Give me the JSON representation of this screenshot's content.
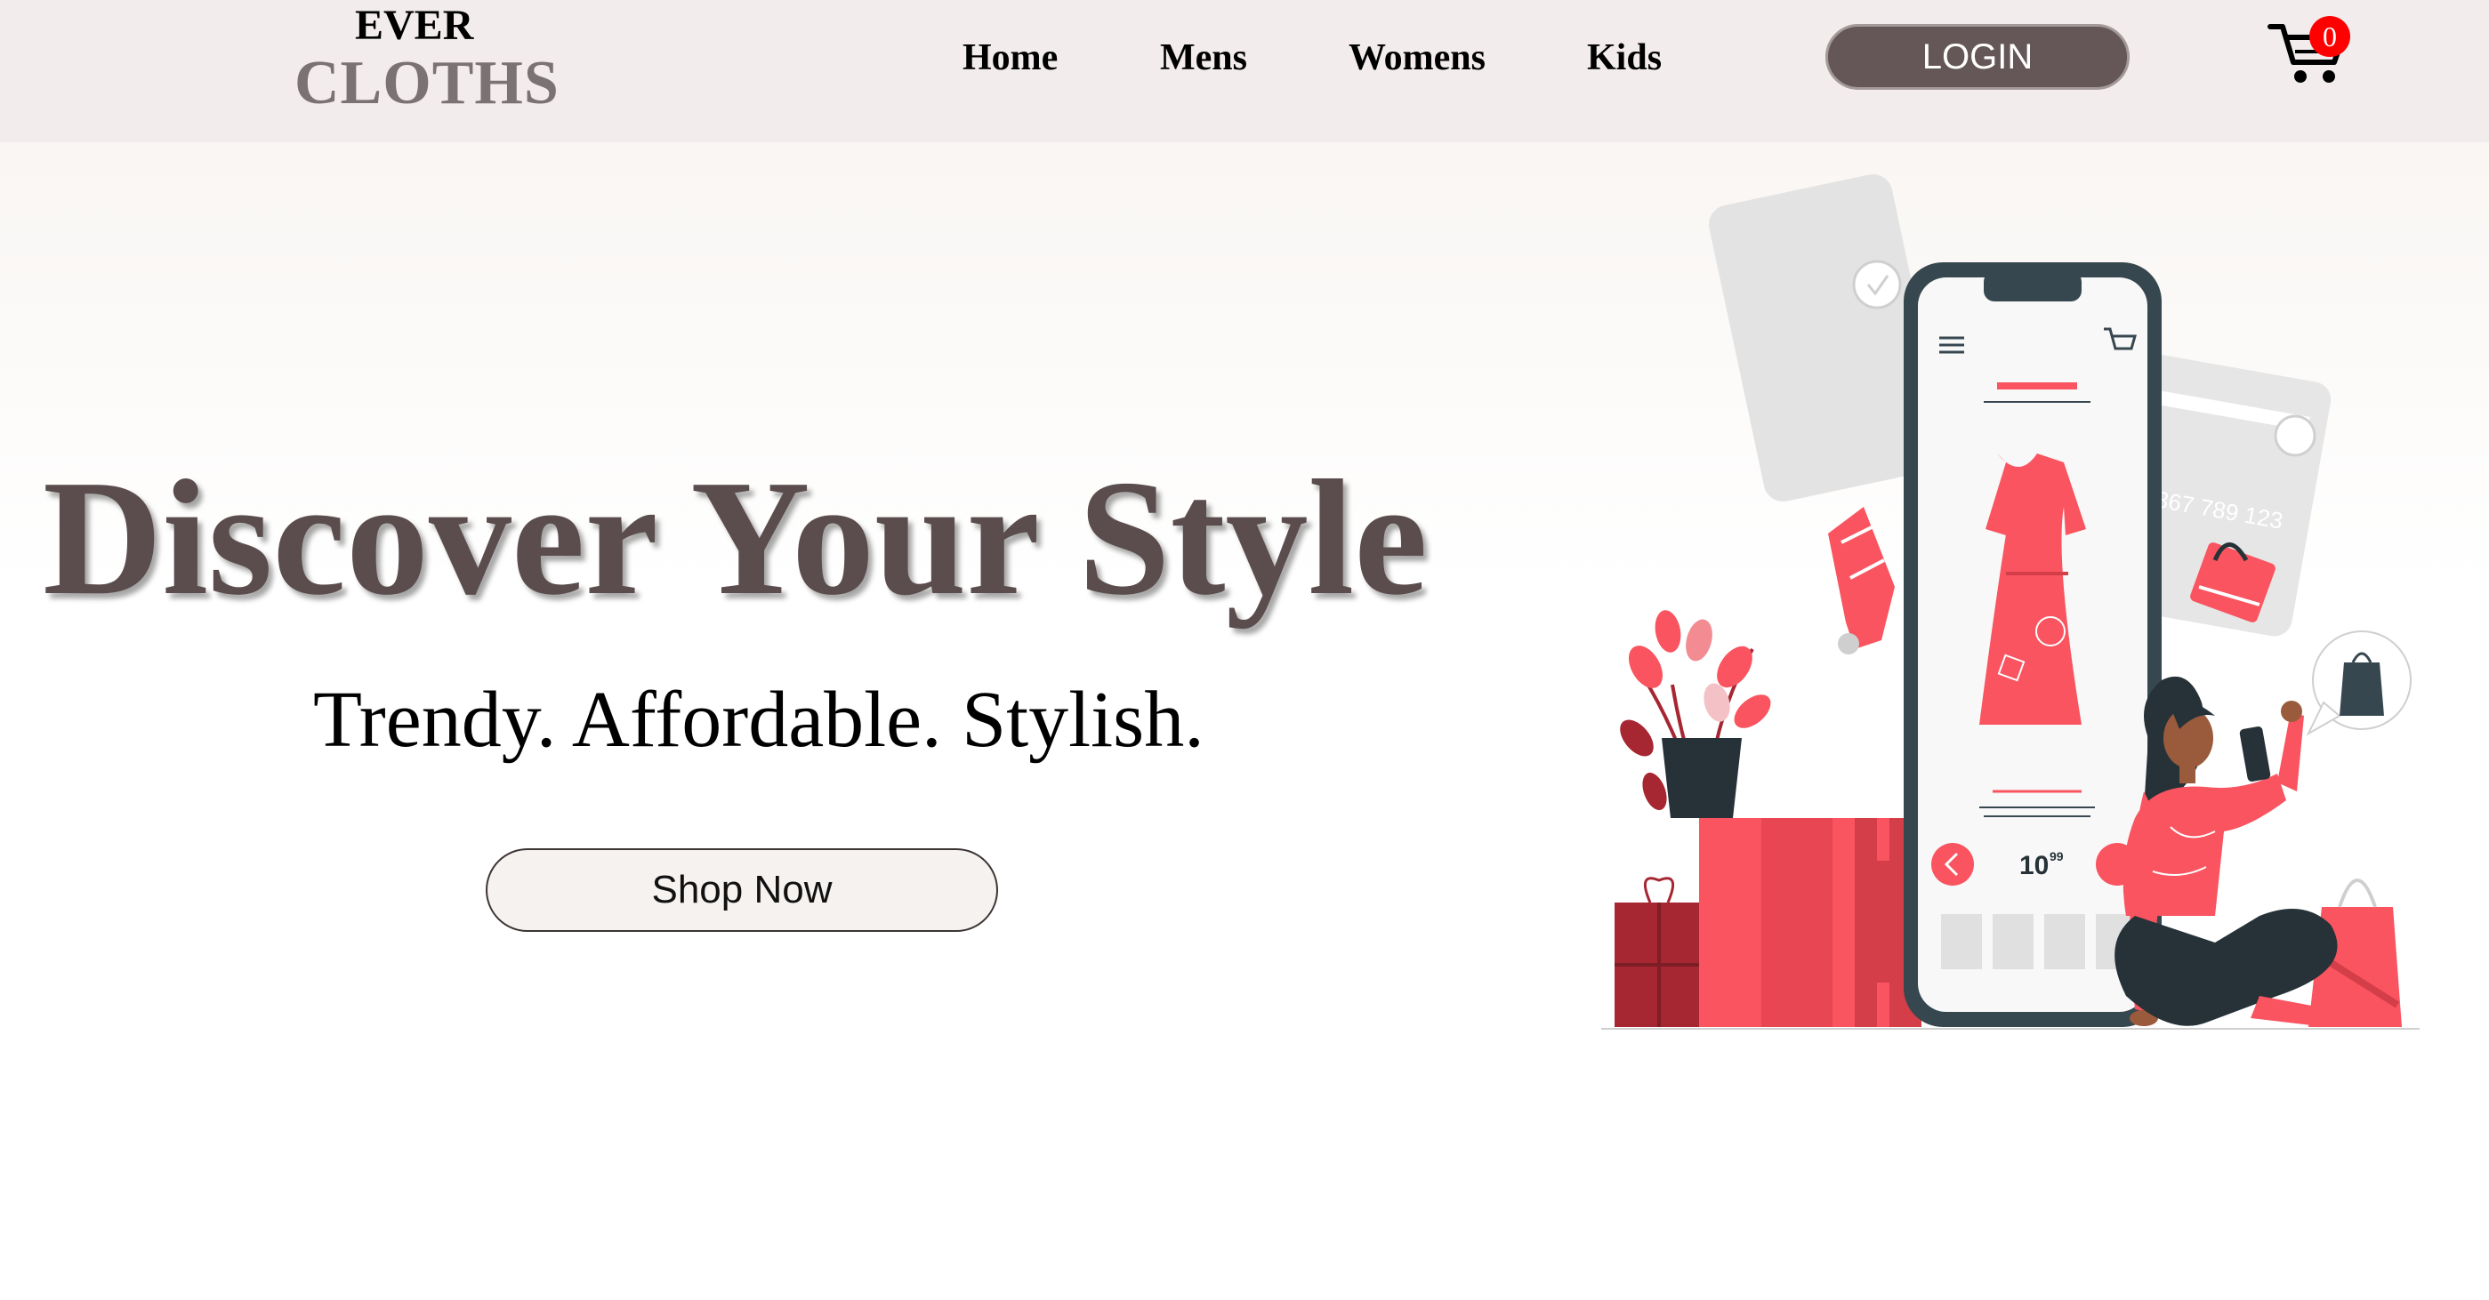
{
  "brand": {
    "line1": "EVER",
    "line2": "CLOTHS"
  },
  "nav": {
    "items": [
      {
        "label": "Home"
      },
      {
        "label": "Mens"
      },
      {
        "label": "Womens"
      },
      {
        "label": "Kids"
      }
    ],
    "login_label": "LOGIN",
    "cart_count": "0"
  },
  "hero": {
    "headline": "Discover Your Style",
    "tagline": "Trendy. Affordable. Stylish.",
    "cta_label": "Shop Now"
  },
  "illustration": {
    "price_main": "10",
    "price_cents": "99",
    "card_number": "56 367 789 123"
  },
  "colors": {
    "navbar_bg": "#f2edec",
    "brand_gray": "#7b7373",
    "headline": "#5b4d4e",
    "login_bg": "#655758",
    "accent_red": "#f9545f",
    "badge_red": "#ff0000"
  },
  "icons": {
    "cart": "shopping-cart-icon"
  }
}
